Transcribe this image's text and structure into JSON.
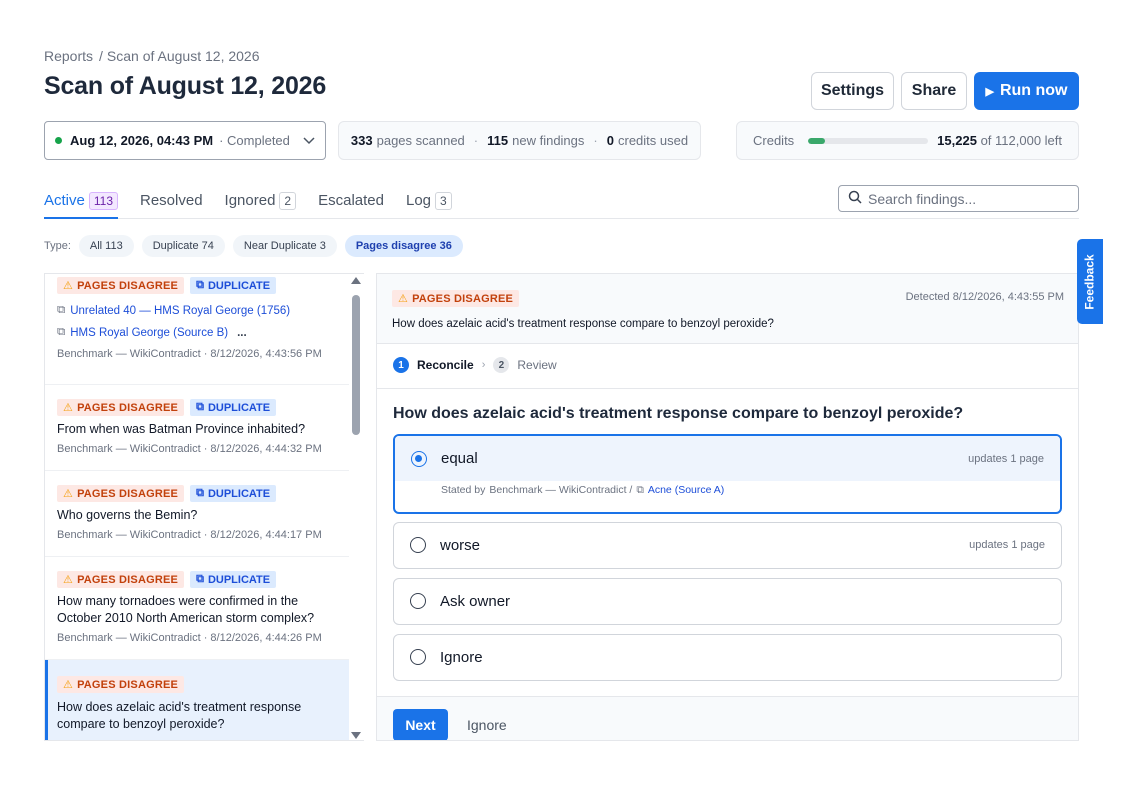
{
  "breadcrumb": {
    "root": "Reports",
    "sep": "/",
    "current": "Scan of August 12, 2026"
  },
  "page_title": "Scan of August 12, 2026",
  "header_buttons": {
    "settings": "Settings",
    "share": "Share",
    "run": "Run now"
  },
  "scan_select": {
    "date": "Aug 12, 2026, 04:43 PM",
    "status": "· Completed"
  },
  "stats": {
    "pages_count": "333",
    "pages_label": "pages scanned",
    "findings_count": "115",
    "findings_label": "new findings",
    "credits_count": "0",
    "credits_label": "credits used",
    "sep": "·"
  },
  "credits": {
    "label": "Credits",
    "remaining": "15,225",
    "suffix": "of 112,000 left",
    "fraction_used": 0.136,
    "bar_color": "#3aa86b"
  },
  "tabs": [
    {
      "label": "Active",
      "count": "113"
    },
    {
      "label": "Resolved",
      "count": ""
    },
    {
      "label": "Ignored",
      "count": "2"
    },
    {
      "label": "Escalated",
      "count": ""
    },
    {
      "label": "Log",
      "count": "3"
    }
  ],
  "search": {
    "placeholder": "Search findings..."
  },
  "filters": {
    "label": "Type:",
    "chips": [
      "All 113",
      "Duplicate 74",
      "Near Duplicate 3",
      "Pages disagree 36"
    ]
  },
  "badge_labels": {
    "pages_disagree": "PAGES DISAGREE",
    "duplicate": "DUPLICATE"
  },
  "findings": [
    {
      "link1": "Unrelated 40 — HMS Royal George (1756)",
      "link2": "HMS Royal George (Source B)",
      "more": "...",
      "meta": "Benchmark — WikiContradict · 8/12/2026, 4:43:56 PM"
    },
    {
      "question": "From when was Batman Province inhabited?",
      "meta": "Benchmark — WikiContradict · 8/12/2026, 4:44:32 PM"
    },
    {
      "question": "Who governs the Bemin?",
      "meta": "Benchmark — WikiContradict · 8/12/2026, 4:44:17 PM"
    },
    {
      "question": "How many tornadoes were confirmed in the October 2010 North American storm complex?",
      "meta": "Benchmark — WikiContradict · 8/12/2026, 4:44:26 PM"
    },
    {
      "question": "How does azelaic acid's treatment response compare to benzoyl peroxide?"
    }
  ],
  "detail": {
    "detected": "Detected 8/12/2026, 4:43:55 PM",
    "question": "How does azelaic acid's treatment response compare to benzoyl peroxide?",
    "steps": [
      {
        "num": "1",
        "label": "Reconcile"
      },
      {
        "num": "2",
        "label": "Review"
      }
    ],
    "step_sep": "›",
    "options": [
      {
        "label": "equal",
        "updates": "updates 1 page",
        "stated_prefix": "Stated by",
        "stated_by": "Benchmark — WikiContradict /",
        "source": "Acne (Source A)"
      },
      {
        "label": "worse",
        "updates": "updates 1 page"
      },
      {
        "label": "Ask owner"
      },
      {
        "label": "Ignore"
      }
    ],
    "next": "Next",
    "ignore": "Ignore"
  },
  "feedback": "Feedback",
  "colors": {
    "accent": "#1a73e8",
    "warning_bg": "#fde8e4",
    "warning_fg": "#c2410c",
    "dup_bg": "#dbeafe"
  }
}
